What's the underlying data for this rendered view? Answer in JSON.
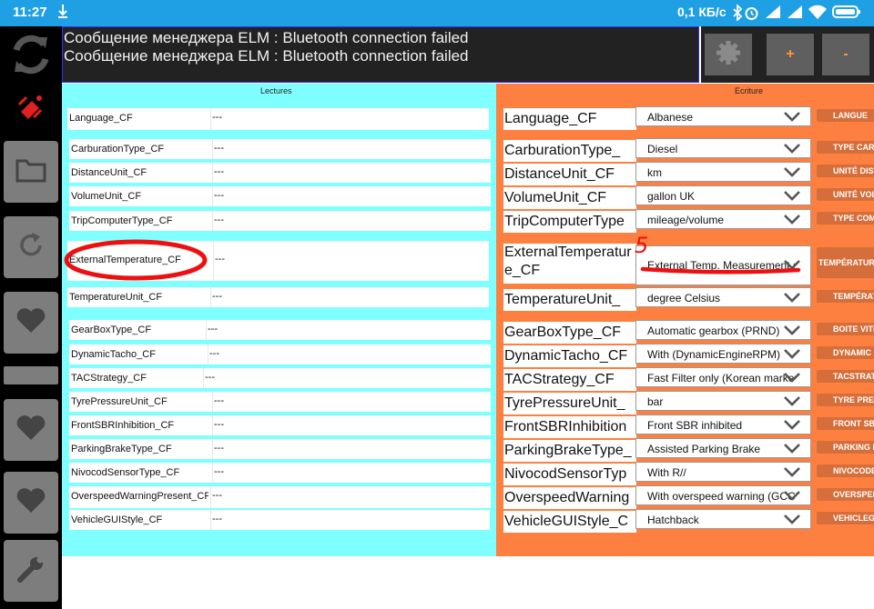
{
  "status_bar": {
    "time": "11:27",
    "usb_icon": "usb-debug-icon",
    "speed": "0,1 КБ/с",
    "icons": [
      "bluetooth-icon",
      "alarm-icon",
      "signal-icon",
      "signal-icon",
      "wifi-icon",
      "battery-icon"
    ]
  },
  "messages": [
    "Сообщение менеджера ELM : Bluetooth connection failed",
    "Сообщение менеджера ELM : Bluetooth connection failed"
  ],
  "top_buttons": {
    "settings_icon": "gear-icon",
    "plus": "+",
    "minus": "-"
  },
  "left_toolbar": [
    "sync-icon",
    "satellite-icon",
    "folder-icon",
    "refresh-icon",
    "heart-icon",
    "heart-icon",
    "heart-icon",
    "wrench-icon"
  ],
  "lectures": {
    "title": "Lectures",
    "rows": [
      {
        "label": "Language_CF",
        "value": "---"
      },
      {
        "label": "CarburationType_CF",
        "value": "---"
      },
      {
        "label": "DistanceUnit_CF",
        "value": "---"
      },
      {
        "label": "VolumeUnit_CF",
        "value": "---"
      },
      {
        "label": "TripComputerType_CF",
        "value": "---"
      },
      {
        "label": "ExternalTemperature_CF",
        "value": "---"
      },
      {
        "label": "TemperatureUnit_CF",
        "value": "---"
      },
      {
        "label": "GearBoxType_CF",
        "value": "---"
      },
      {
        "label": "DynamicTacho_CF",
        "value": "---"
      },
      {
        "label": "TACStrategy_CF",
        "value": "---"
      },
      {
        "label": "TyrePressureUnit_CF",
        "value": "---"
      },
      {
        "label": "FrontSBRInhibition_CF",
        "value": "---"
      },
      {
        "label": "ParkingBrakeType_CF",
        "value": "---"
      },
      {
        "label": "NivocodSensorType_CF",
        "value": "---"
      },
      {
        "label": "OverspeedWarningPresent_CF",
        "value": "---"
      },
      {
        "label": "VehicleGUIStyle_CF",
        "value": "---"
      }
    ]
  },
  "ecriture": {
    "title": "Ecriture",
    "rows": [
      {
        "label": "Language_CF",
        "selected": "Albanese",
        "button": "LANGUE"
      },
      {
        "label": "CarburationType_",
        "selected": "Diesel",
        "button": "TYPE CARBU"
      },
      {
        "label": "DistanceUnit_CF",
        "selected": "km",
        "button": "UNITÉ DIST"
      },
      {
        "label": "VolumeUnit_CF",
        "selected": "gallon UK",
        "button": "UNITÉ VOLU"
      },
      {
        "label": "TripComputerType",
        "selected": "mileage/volume",
        "button": "TYPE COMP"
      },
      {
        "label": "ExternalTemperature_CF",
        "selected": "External Temp. Measurement a...",
        "button": "TEMPÉRATURE"
      },
      {
        "label": "TemperatureUnit_",
        "selected": "degree Celsius",
        "button": "TEMPÉRATU"
      },
      {
        "label": "GearBoxType_CF",
        "selected": "Automatic gearbox (PRND)",
        "button": "BOITE VITE"
      },
      {
        "label": "DynamicTacho_CF",
        "selected": "With (DynamicEngineRPM)",
        "button": "DYNAMIC"
      },
      {
        "label": "TACStrategy_CF",
        "selected": "Fast Filter only (Korean market)",
        "button": "TACSTRAT"
      },
      {
        "label": "TyrePressureUnit_",
        "selected": "bar",
        "button": "TYRE PRESS"
      },
      {
        "label": "FrontSBRInhibition",
        "selected": "Front SBR inhibited",
        "button": "FRONT SBR IN"
      },
      {
        "label": "ParkingBrakeType_",
        "selected": "Assisted Parking Brake",
        "button": "PARKING BRA"
      },
      {
        "label": "NivocodSensorTyp",
        "selected": "With R//",
        "button": "NIVOCODE SEN"
      },
      {
        "label": "OverspeedWarning",
        "selected": "With overspeed warning (GCC...",
        "button": "OVERSPEED W"
      },
      {
        "label": "VehicleGUIStyle_C",
        "selected": "Hatchback",
        "button": "VEHICLEGU"
      }
    ]
  },
  "annotation_mark": "5"
}
